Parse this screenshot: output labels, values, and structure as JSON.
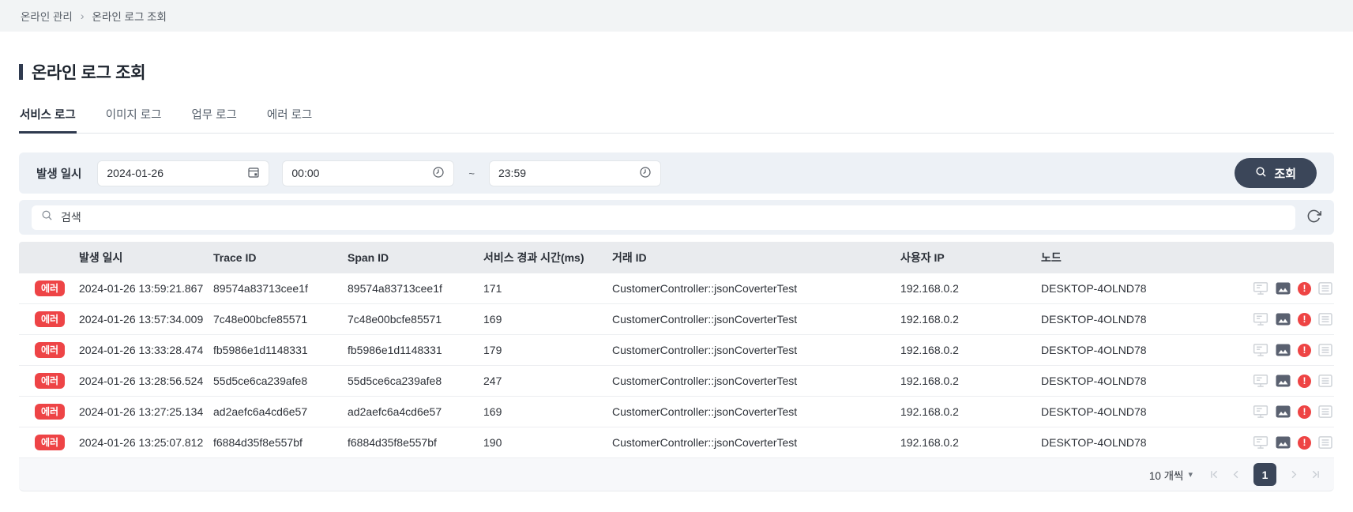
{
  "breadcrumb": {
    "items": [
      "온라인 관리",
      "온라인 로그 조회"
    ],
    "separator": "›"
  },
  "page": {
    "title": "온라인 로그 조회"
  },
  "tabs": [
    {
      "label": "서비스 로그",
      "active": true
    },
    {
      "label": "이미지 로그",
      "active": false
    },
    {
      "label": "업무 로그",
      "active": false
    },
    {
      "label": "에러 로그",
      "active": false
    }
  ],
  "filter": {
    "date_label": "발생 일시",
    "date_value": "2024-01-26",
    "time_from": "00:00",
    "time_to": "23:59",
    "range_separator": "~",
    "search_button_label": "조회"
  },
  "search": {
    "placeholder": "검색"
  },
  "table": {
    "columns": [
      "",
      "발생 일시",
      "Trace ID",
      "Span ID",
      "서비스 경과 시간(ms)",
      "거래 ID",
      "사용자 IP",
      "노드",
      ""
    ],
    "badge_label": "에러",
    "rows": [
      {
        "datetime": "2024-01-26 13:59:21.867",
        "trace_id": "89574a83713cee1f",
        "span_id": "89574a83713cee1f",
        "elapsed_ms": "171",
        "tx_id": "CustomerController::jsonCoverterTest",
        "user_ip": "192.168.0.2",
        "node": "DESKTOP-4OLND78"
      },
      {
        "datetime": "2024-01-26 13:57:34.009",
        "trace_id": "7c48e00bcfe85571",
        "span_id": "7c48e00bcfe85571",
        "elapsed_ms": "169",
        "tx_id": "CustomerController::jsonCoverterTest",
        "user_ip": "192.168.0.2",
        "node": "DESKTOP-4OLND78"
      },
      {
        "datetime": "2024-01-26 13:33:28.474",
        "trace_id": "fb5986e1d1148331",
        "span_id": "fb5986e1d1148331",
        "elapsed_ms": "179",
        "tx_id": "CustomerController::jsonCoverterTest",
        "user_ip": "192.168.0.2",
        "node": "DESKTOP-4OLND78"
      },
      {
        "datetime": "2024-01-26 13:28:56.524",
        "trace_id": "55d5ce6ca239afe8",
        "span_id": "55d5ce6ca239afe8",
        "elapsed_ms": "247",
        "tx_id": "CustomerController::jsonCoverterTest",
        "user_ip": "192.168.0.2",
        "node": "DESKTOP-4OLND78"
      },
      {
        "datetime": "2024-01-26 13:27:25.134",
        "trace_id": "ad2aefc6a4cd6e57",
        "span_id": "ad2aefc6a4cd6e57",
        "elapsed_ms": "169",
        "tx_id": "CustomerController::jsonCoverterTest",
        "user_ip": "192.168.0.2",
        "node": "DESKTOP-4OLND78"
      },
      {
        "datetime": "2024-01-26 13:25:07.812",
        "trace_id": "f6884d35f8e557bf",
        "span_id": "f6884d35f8e557bf",
        "elapsed_ms": "190",
        "tx_id": "CustomerController::jsonCoverterTest",
        "user_ip": "192.168.0.2",
        "node": "DESKTOP-4OLND78"
      }
    ]
  },
  "pagination": {
    "page_size_label": "10 개씩",
    "caret": "▾",
    "current_page": "1"
  },
  "icons": {
    "row_actions": [
      "console-icon",
      "image-icon",
      "error-icon",
      "detail-list-icon"
    ]
  },
  "colors": {
    "accent_navy": "#3b4659",
    "error_red": "#ee4444",
    "filter_bg": "#edf1f6",
    "table_header_bg": "#e9ebee",
    "breadcrumb_bg": "#f2f4f5"
  }
}
